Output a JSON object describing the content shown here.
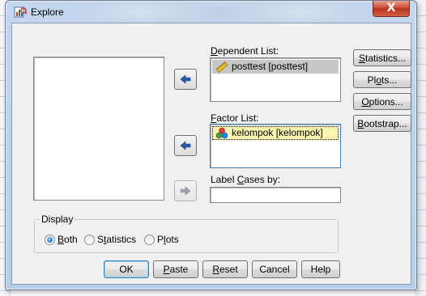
{
  "window": {
    "title": "Explore",
    "close_glyph": "X"
  },
  "panels": {
    "dependent_list": {
      "label_pre": "",
      "label_key": "D",
      "label_post": "ependent List:",
      "items": [
        {
          "label": "posttest [posttest]",
          "icon": "ruler-scale-icon"
        }
      ]
    },
    "factor_list": {
      "label_pre": "",
      "label_key": "F",
      "label_post": "actor List:",
      "items": [
        {
          "label": "kelompok [kelompok]",
          "icon": "nominal-variable-icon"
        }
      ]
    },
    "label_cases": {
      "label_pre": "Label ",
      "label_key": "C",
      "label_post": "ases by:",
      "value": ""
    }
  },
  "side_buttons": [
    {
      "pre": "",
      "key": "S",
      "post": "tatistics..."
    },
    {
      "pre": "Pl",
      "key": "o",
      "post": "ts..."
    },
    {
      "pre": "",
      "key": "O",
      "post": "ptions..."
    },
    {
      "pre": "",
      "key": "B",
      "post": "ootstrap..."
    }
  ],
  "display": {
    "legend": "Display",
    "options": [
      {
        "pre": "",
        "key": "B",
        "post": "oth",
        "checked": true
      },
      {
        "pre": "S",
        "key": "t",
        "post": "atistics",
        "checked": false
      },
      {
        "pre": "P",
        "key": "l",
        "post": "ots",
        "checked": false
      }
    ]
  },
  "bottom_buttons": [
    {
      "pre": "OK",
      "key": "",
      "post": ""
    },
    {
      "pre": "",
      "key": "P",
      "post": "aste"
    },
    {
      "pre": "",
      "key": "R",
      "post": "eset"
    },
    {
      "pre": "Cancel",
      "key": "",
      "post": ""
    },
    {
      "pre": "Help",
      "key": "",
      "post": ""
    }
  ],
  "colors": {
    "selection": "#c7c7c7",
    "focus_selection": "#fbf5b4",
    "arrow": "#2b5aa8"
  }
}
